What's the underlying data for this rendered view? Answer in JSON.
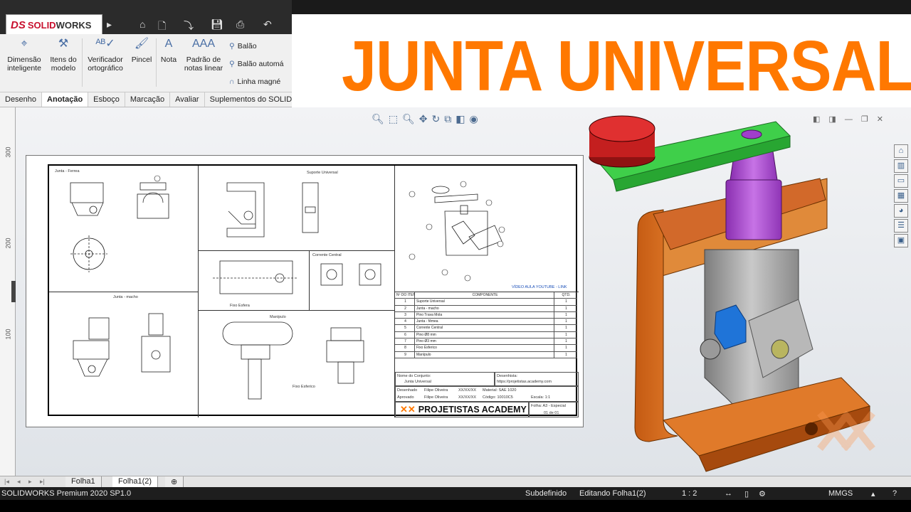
{
  "app": {
    "logo_prefix": "DS",
    "logo_name_a": "SOLID",
    "logo_name_b": "WORKS"
  },
  "ribbon": {
    "buttons": [
      {
        "label": "Dimensão inteligente",
        "icon": "smart-dimension-icon"
      },
      {
        "label": "Itens do modelo",
        "icon": "model-items-icon"
      },
      {
        "label": "Verificador ortográfico",
        "icon": "spell-check-icon"
      },
      {
        "label": "Pincel",
        "icon": "format-painter-icon"
      },
      {
        "label": "Nota",
        "icon": "note-icon"
      },
      {
        "label": "Padrão de notas linear",
        "icon": "linear-note-pattern-icon"
      }
    ],
    "small": [
      {
        "label": "Balão",
        "icon": "balloon-icon"
      },
      {
        "label": "Balão automá",
        "icon": "auto-balloon-icon"
      },
      {
        "label": "Linha magné",
        "icon": "magnetic-line-icon"
      }
    ]
  },
  "tabs": [
    "Desenho",
    "Anotação",
    "Esboço",
    "Marcação",
    "Avaliar",
    "Suplementos do SOLIDWORKS"
  ],
  "active_tab": "Anotação",
  "banner": {
    "title": "JUNTA UNIVERSAL",
    "color": "#ff7800"
  },
  "ruler": [
    "300",
    "200",
    "100"
  ],
  "sheet": {
    "views": {
      "v1": "Junta - Ferrea",
      "v2": "Suporte Universal",
      "v3": "Junta - macho",
      "v4": "Fixo Esfera",
      "v5": "Corrente Central",
      "v6": "Manípulo",
      "v7": "Fixo Esferico",
      "link": "VÍDEO AULA YOUTUBE - LINK"
    },
    "bom": {
      "headers": [
        "Nº DO ITEM",
        "COMPONENTE",
        "QTD."
      ],
      "rows": [
        [
          "1",
          "Suporte Universal",
          "1"
        ],
        [
          "2",
          "Junta - macho",
          "1"
        ],
        [
          "3",
          "Pino Trava Mola",
          "1"
        ],
        [
          "4",
          "Junta - fêmea",
          "1"
        ],
        [
          "5",
          "Corrente Central",
          "1"
        ],
        [
          "6",
          "Pino Ø8 mm",
          "1"
        ],
        [
          "7",
          "Pino Ø3 mm",
          "1"
        ],
        [
          "8",
          "Fixo Esferico",
          "1"
        ],
        [
          "9",
          "Manípulo",
          "1"
        ]
      ]
    },
    "title_block": {
      "nome_conjunto": "Nome do Conjunto:",
      "conjunto": "Junta Universal",
      "desenhista": "Desenhista:",
      "email": "https://projetistas.academy.com",
      "desenhado": "Desenhado",
      "aprovado": "Aprovado",
      "nome1": "Filipe Oliveira",
      "nome2": "Filipe Oliveira",
      "data1": "XX/XX/XX",
      "data2": "XX/XX/XX",
      "material": "Material: SAE 1020",
      "codigo": "Código: 10010C5",
      "escala": "Escala: 1:1",
      "folha": "Folha: A3 - Especial",
      "pagina": "01 de 01",
      "academy": "PROJETISTAS ACADEMY"
    }
  },
  "sheet_tabs": [
    "Folha1",
    "Folha1(2)"
  ],
  "active_sheet": "Folha1(2)",
  "status": {
    "product": "SOLIDWORKS Premium 2020 SP1.0",
    "state": "Subdefinido",
    "editing": "Editando Folha1(2)",
    "scale": "1 : 2",
    "units": "MMGS"
  }
}
